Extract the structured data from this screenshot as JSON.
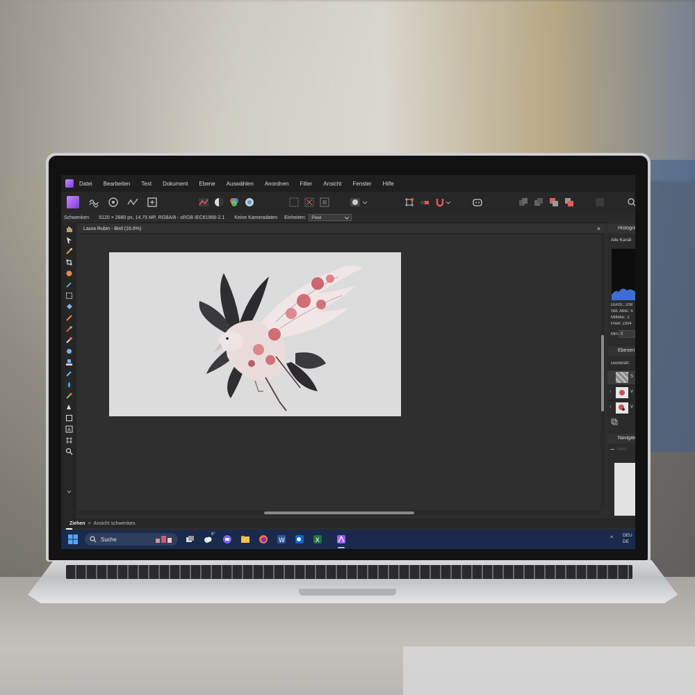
{
  "menu": [
    "Datei",
    "Bearbeiten",
    "Text",
    "Dokument",
    "Ebene",
    "Auswählen",
    "Anordnen",
    "Filter",
    "Ansicht",
    "Fenster",
    "Hilfe"
  ],
  "context_bar": {
    "tool": "Schwenken",
    "doc_info": "5120 × 2880 px, 14.75 MP, RGBA/8 - sRGB IEC61966-2.1",
    "camera": "Keine Kameradaten",
    "units_label": "Einheiten:",
    "units_value": "Pixel"
  },
  "document": {
    "tab_title": "Laura Rubin - Bird (16.6%)",
    "close_glyph": "×"
  },
  "histogram_panel": {
    "title": "Histogra",
    "channel": "Alle Kanäl",
    "stats": [
      "Durch.: 209",
      "Std. Abw.: 5",
      "Mittelw.: 2",
      "Pixel: 2304"
    ],
    "min_label": "Min:",
    "min_value": "0"
  },
  "layers_panel": {
    "title": "Ebenen",
    "opacity_label": "Deckkraft:",
    "layers": [
      {
        "name": "S"
      },
      {
        "name": "V"
      },
      {
        "name": "V"
      }
    ]
  },
  "navigator_panel": {
    "title": "Navigato"
  },
  "status": {
    "action": "Ziehen",
    "separator": "=",
    "description": "Ansicht schwenken."
  },
  "taskbar": {
    "search_placeholder": "Suche",
    "weather_temp": "6°",
    "lang_line1": "DEU",
    "lang_line2": "DE"
  },
  "colors": {
    "app_accent": "#9b5de5",
    "taskbar": "#1a2a4c",
    "ui_background": "#2e2e2e",
    "artboard": "#dcdcdc",
    "blossom": "#c8505a"
  }
}
